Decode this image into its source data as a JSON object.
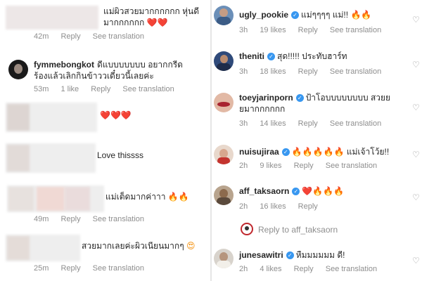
{
  "left": {
    "c1": {
      "text": "แม่ผิวสวยมากกกกกก หุ่นดีมากกกกกก",
      "emoji": "❤️❤️",
      "time": "42m",
      "reply": "Reply",
      "translate": "See translation"
    },
    "c2": {
      "user": "fymmebongkot",
      "text": "ดีแบบบบบบบ อยากกรีดร้องแล้วเลิกกินข้าววเดี๋ยวนี้เลยค่ะ",
      "time": "53m",
      "likes": "1 like",
      "reply": "Reply",
      "translate": "See translation"
    },
    "c3": {
      "emoji": "❤️❤️❤️"
    },
    "c4": {
      "text": "Love thissss"
    },
    "c5": {
      "text": "แม่เต็ดมากค่าาา",
      "emoji": "🔥🔥",
      "time": "49m",
      "reply": "Reply",
      "translate": "See translation"
    },
    "c6": {
      "text": "สวยมากเลยค่ะผิวเนียนมากๆ",
      "emoji": "😍",
      "time": "25m",
      "reply": "Reply",
      "translate": "See translation"
    }
  },
  "right": {
    "r1": {
      "user": "ugly_pookie",
      "text": "แม่ๆๆๆๆ แม่!!",
      "emoji": "🔥🔥",
      "time": "3h",
      "likes": "19 likes",
      "reply": "Reply",
      "translate": "See translation"
    },
    "r2": {
      "user": "theniti",
      "text": "สุด!!!!! ประทับฮาร์ท",
      "time": "3h",
      "likes": "18 likes",
      "reply": "Reply",
      "translate": "See translation"
    },
    "r3": {
      "user": "toeyjarinporn",
      "text": "ป้าโอบบบบบบบบ สวยยยมากกกกกก",
      "time": "3h",
      "likes": "14 likes",
      "reply": "Reply",
      "translate": "See translation"
    },
    "r4": {
      "user": "nuisujiraa",
      "emoji": "🔥🔥🔥🔥🔥",
      "text": "แม่เจ้าโว้ย!!",
      "time": "2h",
      "likes": "9 likes",
      "reply": "Reply",
      "translate": "See translation"
    },
    "r5": {
      "user": "aff_taksaorn",
      "emoji": "❤️🔥🔥🔥",
      "time": "2h",
      "likes": "16 likes",
      "reply": "Reply"
    },
    "reply_to": "Reply to aff_taksaorn",
    "r6": {
      "user": "junesawitri",
      "text": "หืมมมมมม ดี!",
      "time": "2h",
      "likes": "4 likes",
      "reply": "Reply",
      "translate": "See translation"
    }
  },
  "icons": {
    "like": "heart-outline-icon",
    "verified": "verified-badge-icon"
  },
  "colors": {
    "text": "#262626",
    "meta": "#8e8e8e",
    "verified": "#3897f0"
  }
}
